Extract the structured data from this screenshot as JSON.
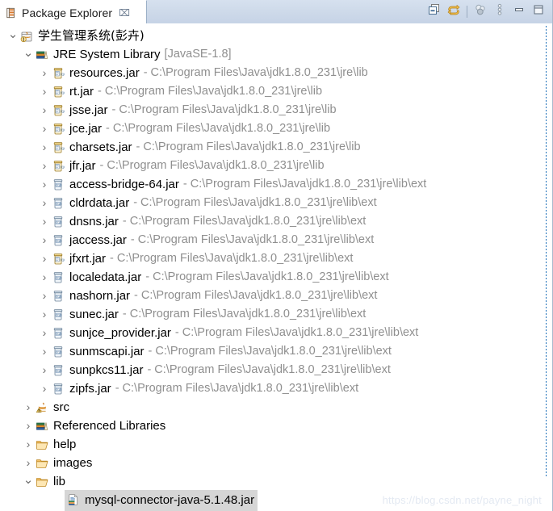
{
  "view": {
    "tab_label": "Package Explorer",
    "tab_icon": "package-explorer-icon",
    "close_label": "⌧"
  },
  "toolbar": {
    "buttons": [
      {
        "name": "collapse-all-button",
        "icon": "collapse-all-icon",
        "tooltip": "Collapse All"
      },
      {
        "name": "link-with-editor-button",
        "icon": "link-with-editor-icon",
        "tooltip": "Link with Editor"
      },
      {
        "name": "focus-on-active-task-button",
        "icon": "focus-task-icon",
        "tooltip": "Focus on Active Task"
      },
      {
        "name": "view-menu-button",
        "icon": "view-menu-icon",
        "tooltip": "View Menu"
      },
      {
        "name": "minimize-button",
        "icon": "minimize-icon",
        "tooltip": "Minimize"
      },
      {
        "name": "maximize-button",
        "icon": "maximize-icon",
        "tooltip": "Maximize"
      }
    ]
  },
  "tree": {
    "rows": [
      {
        "indent": 0,
        "twisty": "expanded",
        "icon": "java-project-icon",
        "label": "学生管理系统(彭卉)",
        "sub": "",
        "cjk": true,
        "selected": false
      },
      {
        "indent": 1,
        "twisty": "expanded",
        "icon": "library-icon",
        "label": "JRE System Library",
        "sub": "[JavaSE-1.8]",
        "cjk": false,
        "selected": false
      },
      {
        "indent": 2,
        "twisty": "collapsed",
        "icon": "jar-lib-icon",
        "label": "resources.jar",
        "sub": "- C:\\Program Files\\Java\\jdk1.8.0_231\\jre\\lib",
        "cjk": false,
        "selected": false
      },
      {
        "indent": 2,
        "twisty": "collapsed",
        "icon": "jar-lib-icon",
        "label": "rt.jar",
        "sub": "- C:\\Program Files\\Java\\jdk1.8.0_231\\jre\\lib",
        "cjk": false,
        "selected": false
      },
      {
        "indent": 2,
        "twisty": "collapsed",
        "icon": "jar-lib-icon",
        "label": "jsse.jar",
        "sub": "- C:\\Program Files\\Java\\jdk1.8.0_231\\jre\\lib",
        "cjk": false,
        "selected": false
      },
      {
        "indent": 2,
        "twisty": "collapsed",
        "icon": "jar-lib-icon",
        "label": "jce.jar",
        "sub": "- C:\\Program Files\\Java\\jdk1.8.0_231\\jre\\lib",
        "cjk": false,
        "selected": false
      },
      {
        "indent": 2,
        "twisty": "collapsed",
        "icon": "jar-lib-icon",
        "label": "charsets.jar",
        "sub": "- C:\\Program Files\\Java\\jdk1.8.0_231\\jre\\lib",
        "cjk": false,
        "selected": false
      },
      {
        "indent": 2,
        "twisty": "collapsed",
        "icon": "jar-lib-icon",
        "label": "jfr.jar",
        "sub": "- C:\\Program Files\\Java\\jdk1.8.0_231\\jre\\lib",
        "cjk": false,
        "selected": false
      },
      {
        "indent": 2,
        "twisty": "collapsed",
        "icon": "jar-ext-icon",
        "label": "access-bridge-64.jar",
        "sub": "- C:\\Program Files\\Java\\jdk1.8.0_231\\jre\\lib\\ext",
        "cjk": false,
        "selected": false
      },
      {
        "indent": 2,
        "twisty": "collapsed",
        "icon": "jar-ext-icon",
        "label": "cldrdata.jar",
        "sub": "- C:\\Program Files\\Java\\jdk1.8.0_231\\jre\\lib\\ext",
        "cjk": false,
        "selected": false
      },
      {
        "indent": 2,
        "twisty": "collapsed",
        "icon": "jar-ext-icon",
        "label": "dnsns.jar",
        "sub": "- C:\\Program Files\\Java\\jdk1.8.0_231\\jre\\lib\\ext",
        "cjk": false,
        "selected": false
      },
      {
        "indent": 2,
        "twisty": "collapsed",
        "icon": "jar-ext-icon",
        "label": "jaccess.jar",
        "sub": "- C:\\Program Files\\Java\\jdk1.8.0_231\\jre\\lib\\ext",
        "cjk": false,
        "selected": false
      },
      {
        "indent": 2,
        "twisty": "collapsed",
        "icon": "jar-lib-icon",
        "label": "jfxrt.jar",
        "sub": "- C:\\Program Files\\Java\\jdk1.8.0_231\\jre\\lib\\ext",
        "cjk": false,
        "selected": false
      },
      {
        "indent": 2,
        "twisty": "collapsed",
        "icon": "jar-ext-icon",
        "label": "localedata.jar",
        "sub": "- C:\\Program Files\\Java\\jdk1.8.0_231\\jre\\lib\\ext",
        "cjk": false,
        "selected": false
      },
      {
        "indent": 2,
        "twisty": "collapsed",
        "icon": "jar-ext-icon",
        "label": "nashorn.jar",
        "sub": "- C:\\Program Files\\Java\\jdk1.8.0_231\\jre\\lib\\ext",
        "cjk": false,
        "selected": false
      },
      {
        "indent": 2,
        "twisty": "collapsed",
        "icon": "jar-ext-icon",
        "label": "sunec.jar",
        "sub": "- C:\\Program Files\\Java\\jdk1.8.0_231\\jre\\lib\\ext",
        "cjk": false,
        "selected": false
      },
      {
        "indent": 2,
        "twisty": "collapsed",
        "icon": "jar-ext-icon",
        "label": "sunjce_provider.jar",
        "sub": "- C:\\Program Files\\Java\\jdk1.8.0_231\\jre\\lib\\ext",
        "cjk": false,
        "selected": false
      },
      {
        "indent": 2,
        "twisty": "collapsed",
        "icon": "jar-ext-icon",
        "label": "sunmscapi.jar",
        "sub": "- C:\\Program Files\\Java\\jdk1.8.0_231\\jre\\lib\\ext",
        "cjk": false,
        "selected": false
      },
      {
        "indent": 2,
        "twisty": "collapsed",
        "icon": "jar-ext-icon",
        "label": "sunpkcs11.jar",
        "sub": "- C:\\Program Files\\Java\\jdk1.8.0_231\\jre\\lib\\ext",
        "cjk": false,
        "selected": false
      },
      {
        "indent": 2,
        "twisty": "collapsed",
        "icon": "jar-ext-icon",
        "label": "zipfs.jar",
        "sub": "- C:\\Program Files\\Java\\jdk1.8.0_231\\jre\\lib\\ext",
        "cjk": false,
        "selected": false
      },
      {
        "indent": 1,
        "twisty": "collapsed",
        "icon": "source-folder-warning-icon",
        "label": "src",
        "sub": "",
        "cjk": false,
        "selected": false
      },
      {
        "indent": 1,
        "twisty": "collapsed",
        "icon": "library-icon",
        "label": "Referenced Libraries",
        "sub": "",
        "cjk": false,
        "selected": false
      },
      {
        "indent": 1,
        "twisty": "collapsed",
        "icon": "folder-icon",
        "label": "help",
        "sub": "",
        "cjk": false,
        "selected": false
      },
      {
        "indent": 1,
        "twisty": "collapsed",
        "icon": "folder-icon",
        "label": "images",
        "sub": "",
        "cjk": false,
        "selected": false
      },
      {
        "indent": 1,
        "twisty": "expanded",
        "icon": "folder-icon",
        "label": "lib",
        "sub": "",
        "cjk": false,
        "selected": false
      },
      {
        "indent": 3,
        "twisty": "none",
        "icon": "jar-file-icon",
        "label": "mysql-connector-java-5.1.48.jar",
        "sub": "",
        "cjk": false,
        "selected": true
      }
    ]
  },
  "watermark": {
    "text": "https://blog.csdn.net/payne_night"
  },
  "colors": {
    "header_bg": "#cdd9e9",
    "header_border": "#9cb0c8",
    "selection_bg": "#d6d6d6",
    "path_text": "#8f8f8f",
    "label_text": "#000000",
    "focus_dots": "#1d6fb8",
    "watermark": "#e3e9f2"
  }
}
